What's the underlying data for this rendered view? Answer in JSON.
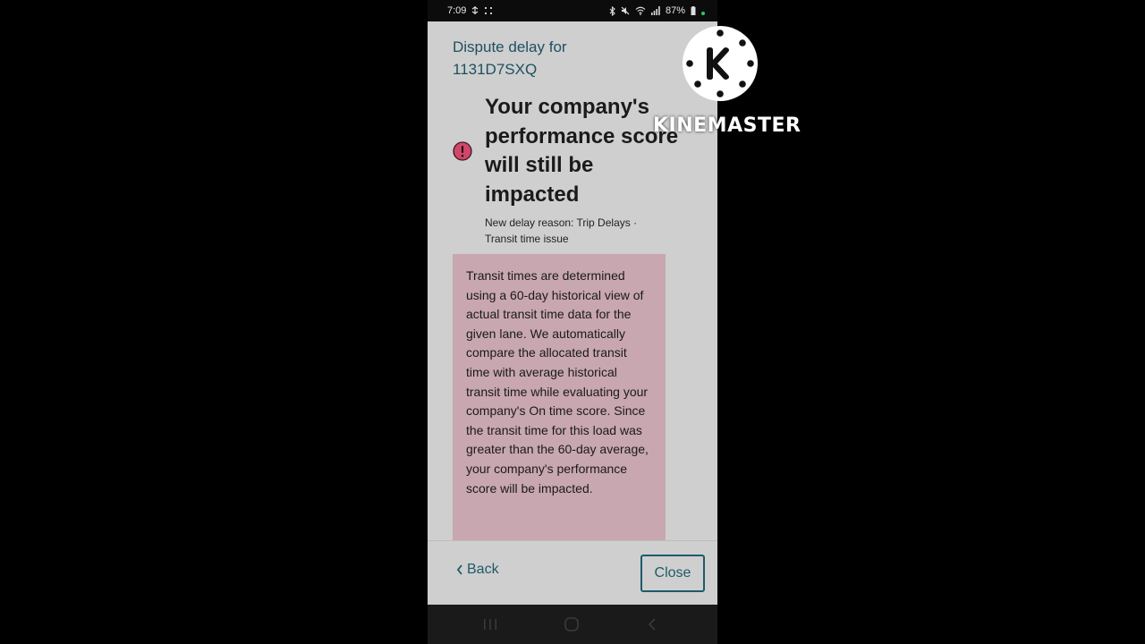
{
  "status_bar": {
    "time": "7:09",
    "battery": "87%",
    "left_icons": [
      "usb-debug-icon",
      "dots-icon"
    ],
    "right_icons": [
      "bluetooth-icon",
      "mute-icon",
      "wifi-icon",
      "signal-icon",
      "battery-icon"
    ]
  },
  "modal": {
    "title": "Dispute delay for 1131D7SXQ",
    "headline": "Your company's performance score will still be impacted",
    "reason": "New delay reason: Trip Delays · Transit time issue",
    "info_text": "Transit times are determined using a 60-day historical view of actual transit time data for the given lane. We automatically compare the allocated transit time with average historical transit time while evaluating your company's On time score. Since the transit time for this load was greater than the 60-day average, your company's performance score will be impacted.",
    "back_label": "Back",
    "close_label": "Close"
  },
  "watermark": {
    "text": "KINEMASTER"
  },
  "colors": {
    "accent": "#1e5a6a",
    "error": "#d0476a",
    "info_background": "#c8a7b1",
    "screen_background": "#cfcfcf"
  }
}
